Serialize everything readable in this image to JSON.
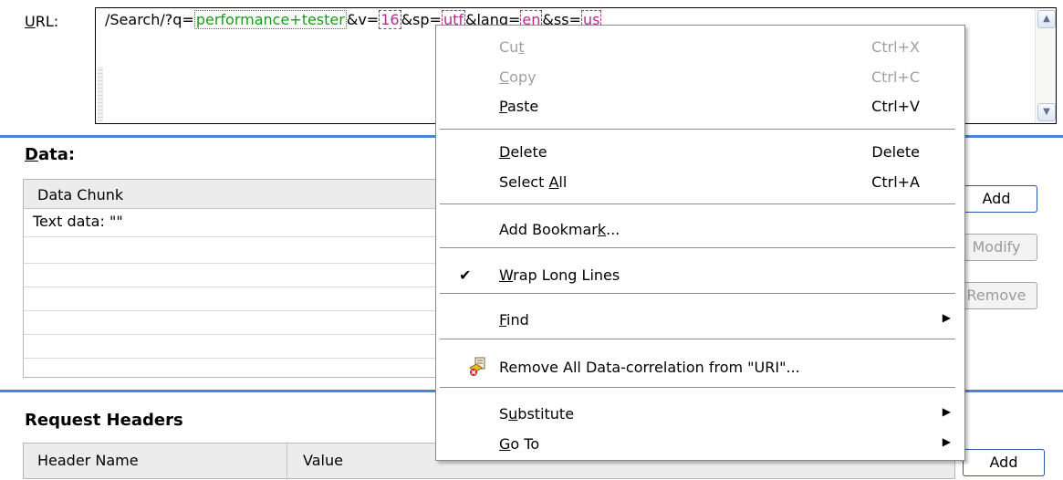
{
  "url": {
    "label_u": "U",
    "label_rest": "RL:",
    "prefix": "/Search/?q=",
    "param_q": "performance+tester",
    "mid1": "&v=",
    "param_v": "16",
    "mid2": "&sp=",
    "param_sp": "utf",
    "mid3": "&lang=",
    "param_lang": "en",
    "mid4": "&ss=",
    "param_ss": "us"
  },
  "data_section": {
    "title_u": "D",
    "title_rest": "ata:",
    "column_header": "Data Chunk",
    "rows": [
      "Text data: \"\""
    ]
  },
  "buttons": {
    "add": "Add",
    "modify": "Modify",
    "remove": "Remove",
    "add2": "Add"
  },
  "headers_section": {
    "title": "Request Headers",
    "col_name": "Header Name",
    "col_value": "Value"
  },
  "context_menu": {
    "cut": {
      "pre": "Cu",
      "u": "t",
      "post": "",
      "shortcut": "Ctrl+X"
    },
    "copy": {
      "pre": "",
      "u": "C",
      "post": "opy",
      "shortcut": "Ctrl+C"
    },
    "paste": {
      "pre": "",
      "u": "P",
      "post": "aste",
      "shortcut": "Ctrl+V"
    },
    "delete": {
      "pre": "",
      "u": "D",
      "post": "elete",
      "shortcut": "Delete"
    },
    "select_all": {
      "pre": "Select ",
      "u": "A",
      "post": "ll",
      "shortcut": "Ctrl+A"
    },
    "add_bookmark": {
      "pre": "Add Bookmar",
      "u": "k",
      "post": "..."
    },
    "wrap": {
      "pre": "",
      "u": "W",
      "post": "rap Long Lines",
      "checked": true
    },
    "find": {
      "pre": "",
      "u": "F",
      "post": "ind"
    },
    "remove_corr": {
      "text": "Remove All Data-correlation from \"URI\"..."
    },
    "substitute": {
      "pre": "S",
      "u": "u",
      "post": "bstitute"
    },
    "goto": {
      "pre": "",
      "u": "G",
      "post": "o To"
    }
  },
  "colors": {
    "accent": "#4a84d8",
    "param_green": "#1a9a1a",
    "param_pink": "#b0308a"
  }
}
